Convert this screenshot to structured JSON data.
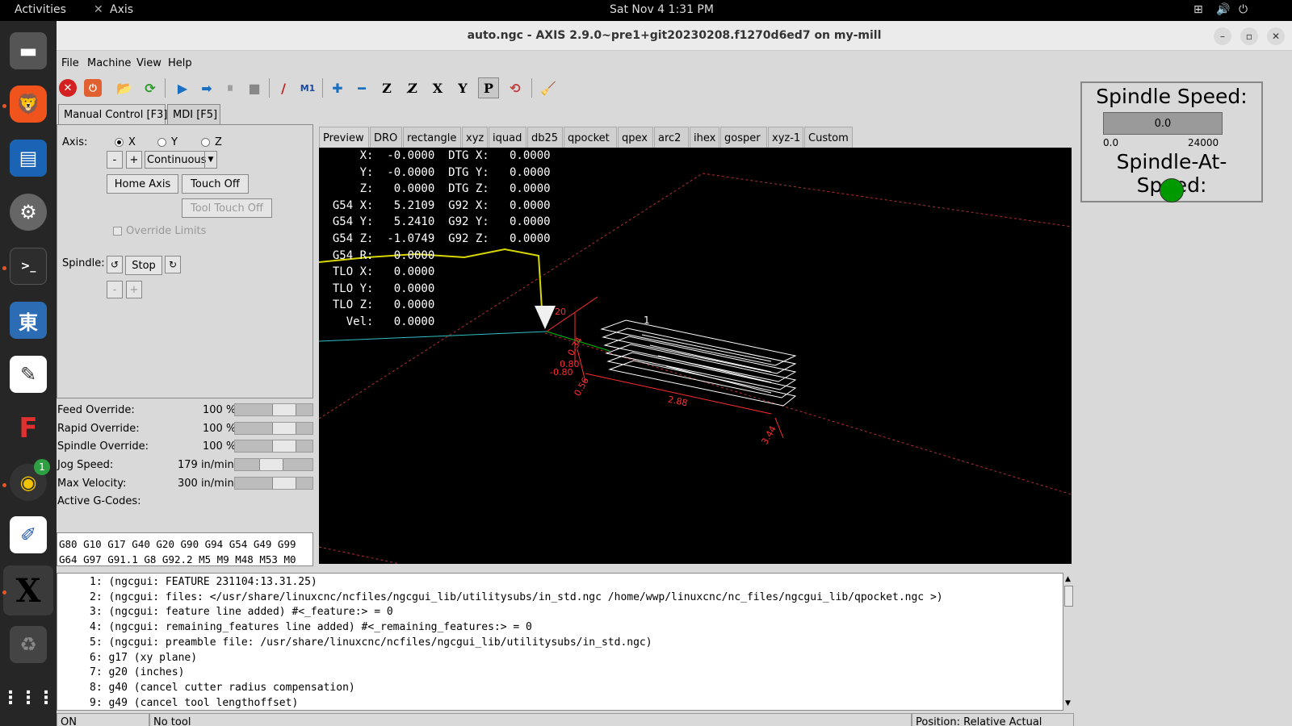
{
  "topbar": {
    "activities": "Activities",
    "app_name": "Axis",
    "clock": "Sat Nov 4  1:31 PM"
  },
  "dock": {
    "badge_count": "1"
  },
  "window": {
    "title": "auto.ngc - AXIS 2.9.0~pre1+git20230208.f1270d6ed7 on my-mill"
  },
  "menu": [
    "File",
    "Machine",
    "View",
    "Help"
  ],
  "left_tabs": [
    "Manual Control [F3]",
    "MDI [F5]"
  ],
  "manual": {
    "axis_label": "Axis:",
    "axes": [
      "X",
      "Y",
      "Z"
    ],
    "selected_axis": "X",
    "jog_minus": "-",
    "jog_plus": "+",
    "jog_mode": "Continuous",
    "home_axis": "Home Axis",
    "touch_off": "Touch Off",
    "tool_touch_off": "Tool Touch Off",
    "override_limits": "Override Limits",
    "spindle_label": "Spindle:",
    "spindle_stop": "Stop",
    "spd_minus": "-",
    "spd_plus": "+"
  },
  "overrides": [
    {
      "label": "Feed Override:",
      "value": "100 %",
      "fraction": 0.7
    },
    {
      "label": "Rapid Override:",
      "value": "100 %",
      "fraction": 0.7
    },
    {
      "label": "Spindle Override:",
      "value": "100 %",
      "fraction": 0.7
    },
    {
      "label": "Jog Speed:",
      "value": "179 in/min",
      "fraction": 0.45
    },
    {
      "label": "Max Velocity:",
      "value": "300 in/min",
      "fraction": 0.7
    }
  ],
  "active_gcodes": {
    "label": "Active G-Codes:",
    "line1": "G80 G10 G17 G40 G20 G90 G94 G54 G49 G99",
    "line2": "G64 G97 G91.1 G8 G92.2 M5 M9 M48 M53 M0"
  },
  "right_tabs": [
    "Preview",
    "DRO",
    "rectangle",
    "xyz",
    "iquad",
    "db25",
    "qpocket",
    "qpex",
    "arc2",
    "ihex",
    "gosper",
    "xyz-1",
    "Custom"
  ],
  "dro": [
    "      X:  -0.0000  DTG X:   0.0000",
    "      Y:  -0.0000  DTG Y:   0.0000",
    "      Z:   0.0000  DTG Z:   0.0000",
    "  G54 X:   5.2109  G92 X:   0.0000",
    "  G54 Y:   5.2410  G92 Y:   0.0000",
    "  G54 Z:  -1.0749  G92 Z:   0.0000",
    "  G54 R:   0.0000",
    "  TLO X:   0.0000",
    "  TLO Y:   0.0000",
    "  TLO Z:   0.0000",
    "    Vel:   0.0000"
  ],
  "preview_labels": {
    "d1": "1",
    "d2": "20",
    "d3": "2.88",
    "d4": "3.44",
    "d5": "0.56",
    "d6": "0.80",
    "d7": "0.34",
    "d8": "-0.80"
  },
  "console": [
    "1: (ngcgui: FEATURE 231104:13.31.25)",
    "2: (ngcgui: files: </usr/share/linuxcnc/ncfiles/ngcgui_lib/utilitysubs/in_std.ngc /home/wwp/linuxcnc/nc_files/ngcgui_lib/qpocket.ngc >)",
    "3: (ngcgui: feature line added) #<_feature:> = 0",
    "4: (ngcgui: remaining_features line added) #<_remaining_features:> = 0",
    "5: (ngcgui: preamble file: /usr/share/linuxcnc/ncfiles/ngcgui_lib/utilitysubs/in_std.ngc)",
    "6: g17 (xy plane)",
    "7: g20 (inches)",
    "8: g40 (cancel cutter radius compensation)",
    "9: g49 (cancel tool lengthoffset)"
  ],
  "status": {
    "machine": "ON",
    "tool": "No tool",
    "position": "Position: Relative Actual"
  },
  "spindle_panel": {
    "speed_label": "Spindle Speed:",
    "speed_value": "0.0",
    "min": "0.0",
    "max": "24000",
    "at_speed_label": "Spindle-At-Speed:",
    "led_color": "#009900"
  }
}
